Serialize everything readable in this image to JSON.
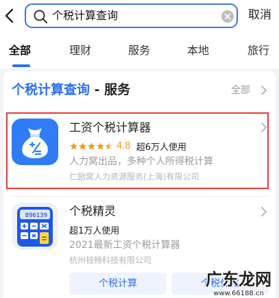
{
  "search": {
    "query": "个税计算查询",
    "cancel_label": "取消"
  },
  "tabs": [
    {
      "label": "全部",
      "active": true
    },
    {
      "label": "理财"
    },
    {
      "label": "服务"
    },
    {
      "label": "本地"
    },
    {
      "label": "旅行"
    }
  ],
  "section": {
    "title_highlight": "个税计算查询",
    "title_rest": " - 服务",
    "all_label": "全部"
  },
  "apps": [
    {
      "name": "工资个税计算器",
      "rating": "4.8",
      "stars": 4.5,
      "users": "超6万人使用",
      "description": "人力窝出品，多种个人所得税计算",
      "company": "仁励窝人力资源服务(上海)有限公司",
      "icon": "money-bag-icon",
      "icon_color": "#2f7cf6"
    },
    {
      "name": "个税精灵",
      "users": "超1万人使用",
      "description": "2021最新工资个税计算器",
      "company": "杭州钱畅科技有限公司",
      "icon": "calculator-icon",
      "calc_display": "896139",
      "sub_buttons": [
        "个税计算",
        "个税优化"
      ]
    }
  ],
  "watermark": {
    "text": "广东龙网",
    "site": "www.66188.cn"
  },
  "colors": {
    "accent": "#2d6ff0",
    "highlight_border": "#e53935",
    "star": "#f39a12"
  }
}
